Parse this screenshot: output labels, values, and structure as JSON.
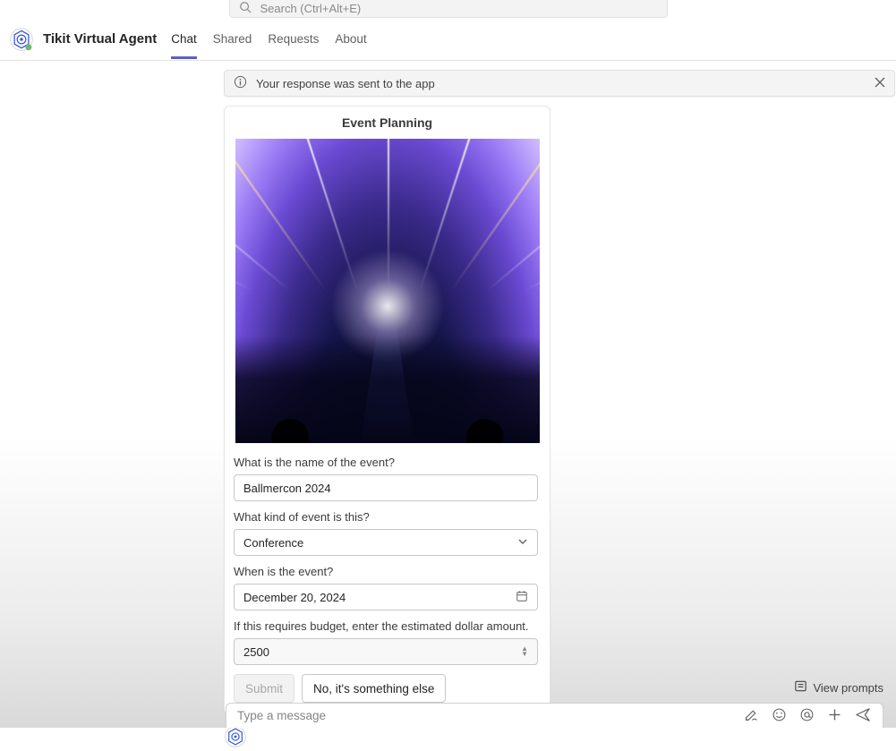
{
  "search": {
    "placeholder": "Search (Ctrl+Alt+E)"
  },
  "header": {
    "app_name": "Tikit Virtual Agent",
    "tabs": [
      {
        "label": "Chat",
        "active": true
      },
      {
        "label": "Shared",
        "active": false
      },
      {
        "label": "Requests",
        "active": false
      },
      {
        "label": "About",
        "active": false
      }
    ]
  },
  "notification": {
    "text": "Your response was sent to the app"
  },
  "card": {
    "title": "Event Planning",
    "fields": {
      "name_label": "What is the name of the event?",
      "name_value": "Ballmercon 2024",
      "kind_label": "What kind of event is this?",
      "kind_value": "Conference",
      "date_label": "When is the event?",
      "date_value": "December 20, 2024",
      "budget_label": "If this requires budget, enter the estimated dollar amount.",
      "budget_value": "2500"
    },
    "actions": {
      "submit": "Submit",
      "alt": "No, it's something else"
    }
  },
  "footer": {
    "view_prompts": "View prompts",
    "compose_placeholder": "Type a message"
  }
}
